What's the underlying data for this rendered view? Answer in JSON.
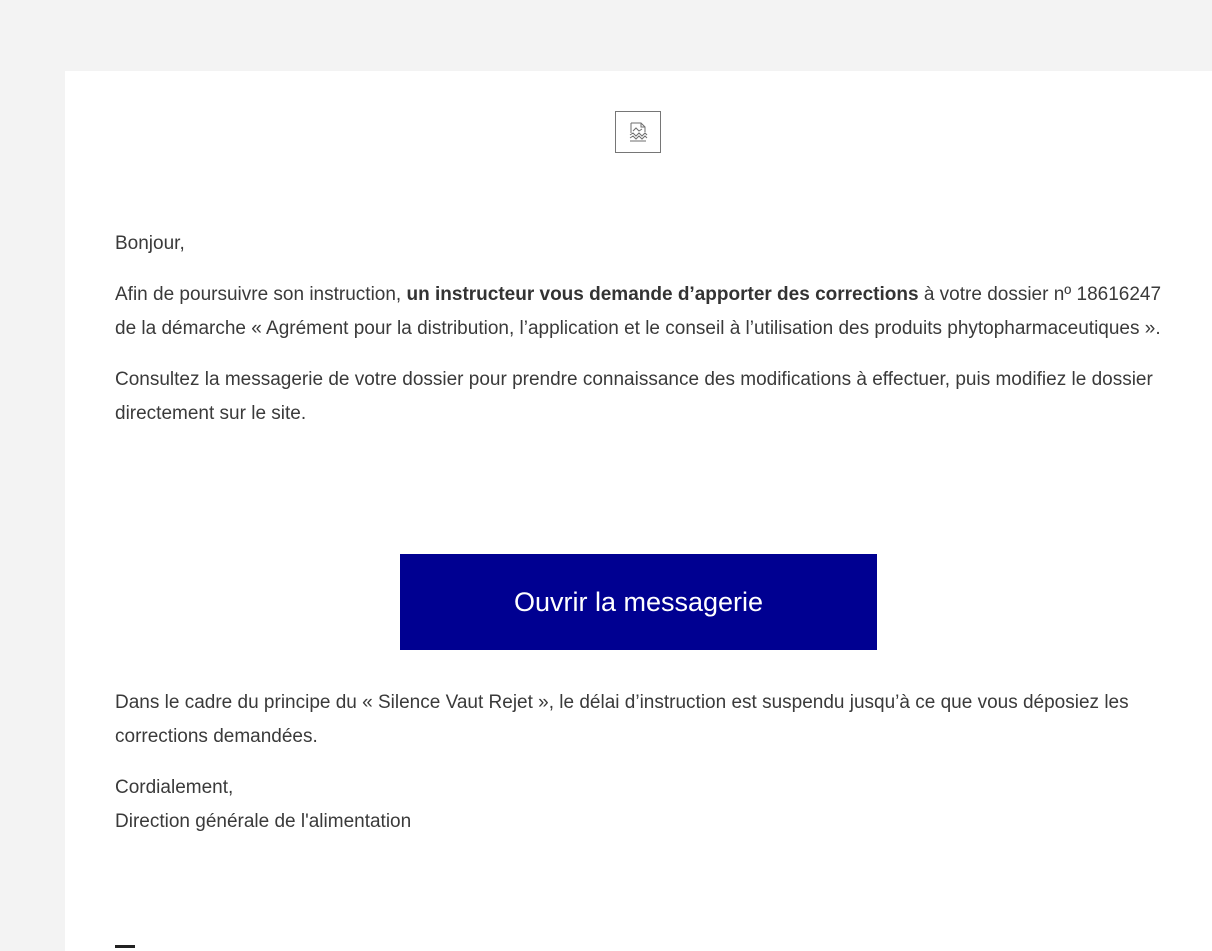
{
  "email": {
    "greeting": "Bonjour,",
    "paragraph_1": {
      "before": "Afin de poursuivre son instruction, ",
      "bold": "un instructeur vous demande d’apporter des corrections",
      "after": " à votre dossier nº 18616247 de la démarche « Agrément pour la distribution, l’application et le conseil à l’utilisation des produits phytopharmaceutiques »."
    },
    "paragraph_2": "Consultez la messagerie de votre dossier pour prendre connaissance des modifications à effectuer, puis modifiez le dossier directement sur le site.",
    "button_label": "Ouvrir la messagerie",
    "paragraph_3": "Dans le cadre du principe du « Silence Vaut Rejet », le délai d’instruction est suspendu jusqu’à ce que vous déposiez les corrections demandées.",
    "closing": "Cordialement,",
    "signature": "Direction générale de l'alimentation"
  },
  "colors": {
    "background": "#f3f3f3",
    "card": "#ffffff",
    "button": "#000091",
    "button_text": "#ffffff",
    "text": "#3a3a3a"
  },
  "icons": {
    "logo": "broken-image-icon"
  }
}
